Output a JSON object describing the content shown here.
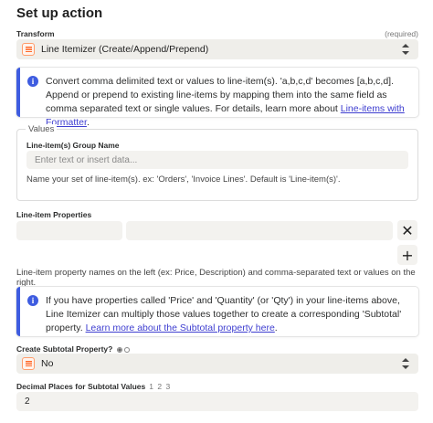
{
  "title": "Set up action",
  "transform": {
    "label": "Transform",
    "required": "(required)",
    "value": "Line Itemizer (Create/Append/Prepend)"
  },
  "info1": {
    "text": "Convert comma delimited text or values to line-item(s). 'a,b,c,d' becomes [a,b,c,d]. Append or prepend to existing line-items by mapping them into the same field as comma separated text or single values. For details, learn more about ",
    "link": "Line-items with Formatter",
    "end": "."
  },
  "values_group": {
    "legend": "Values",
    "label": "Line-item(s) Group Name",
    "placeholder": "Enter text or insert data...",
    "hint": "Name your set of line-item(s). ex: 'Orders', 'Invoice Lines'. Default is 'Line-item(s)'."
  },
  "line_item_properties": {
    "label": "Line-item Properties",
    "remove_symbol": "✕",
    "add_symbol": "+",
    "hint": "Line-item property names on the left (ex: Price, Description) and comma-separated text or values on the right."
  },
  "info2": {
    "text": "If you have properties called 'Price' and 'Quantity' (or 'Qty') in your line-items above, Line Itemizer can multiply those values together to create a corresponding 'Subtotal' property. ",
    "link": "Learn more about the Subtotal property here",
    "end": "."
  },
  "subtotal": {
    "label": "Create Subtotal Property?",
    "value": "No"
  },
  "decimal": {
    "label": "Decimal Places for Subtotal Values",
    "options": "1 2 3",
    "value": "2"
  },
  "colors": {
    "accent": "#3e5ce0",
    "app_icon": "#ff6a2b",
    "field_bg": "#efeeea"
  }
}
